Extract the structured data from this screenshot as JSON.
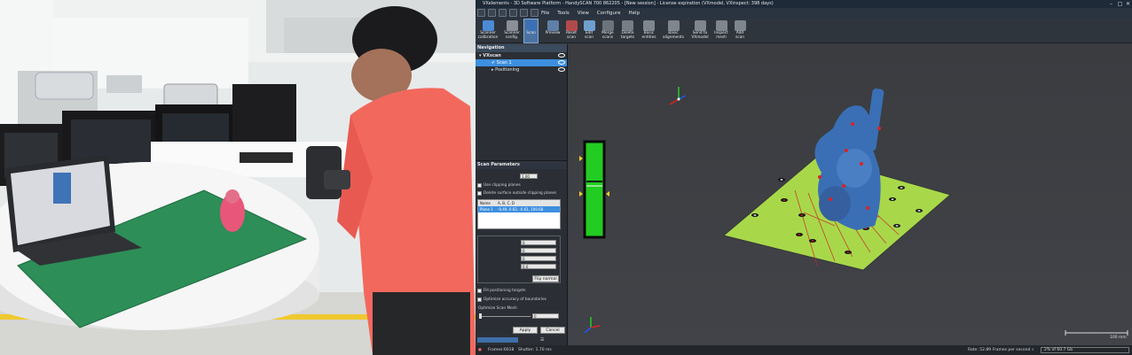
{
  "app": {
    "title": "VXelements - 3D Software Platform - HandySCAN 700 862205 - [New session] - License expiration (VXmodel, VXinspect: 398 days)",
    "window_buttons": [
      "–",
      "□",
      "✕"
    ],
    "menu": [
      "File",
      "Tools",
      "View",
      "Configure",
      "Help"
    ],
    "toolbar": [
      {
        "label": "Scanner\ncalibration",
        "icon": "calibration-icon"
      },
      {
        "label": "Scanner\nconfig.",
        "icon": "scanner-config-icon"
      },
      {
        "label": "Scan",
        "icon": "scan-icon",
        "active": true
      },
      {
        "label": "Preview",
        "icon": "preview-icon"
      },
      {
        "label": "Reset\nscan",
        "icon": "reset-icon"
      },
      {
        "label": "Edit\nscan",
        "icon": "edit-icon"
      },
      {
        "label": "Merge\nscans",
        "icon": "merge-icon"
      },
      {
        "label": "Delete\ntargets",
        "icon": "delete-targets-icon"
      },
      {
        "label": "Basic\nentities",
        "icon": "entities-icon"
      },
      {
        "label": "Basic\nalignments",
        "icon": "alignments-icon"
      },
      {
        "label": "Send to\nVXmodel",
        "icon": "send-icon"
      },
      {
        "label": "Inspect\nmesh",
        "icon": "inspect-icon"
      },
      {
        "label": "Add\nscan",
        "icon": "add-scan-icon"
      }
    ],
    "navigation": {
      "title": "Navigation",
      "root": "VXscan",
      "items": [
        {
          "label": "Scan 1",
          "selected": true
        },
        {
          "label": "Positioning",
          "selected": false
        }
      ]
    },
    "scan_params": {
      "title": "Scan Parameters",
      "resolution_value": "1.00",
      "use_clipping_planes": "Use clipping planes",
      "delete_surface": "Delete surface outside clipping planes",
      "table_headers": [
        "Name",
        "A, B, C, D"
      ],
      "table_rows": [
        [
          "Plane 1",
          "-0.49, 0.62, -0.61, 100.68"
        ]
      ],
      "fields": [
        "0",
        "0",
        "0",
        "0.0"
      ],
      "flip_normal": "Flip normal",
      "fill_targets": "Fill positioning targets",
      "optimize_accuracy": "Optimize accuracy of boundaries",
      "optimize_mesh": "Optimize Scan Mesh",
      "slider_value": "0",
      "apply": "Apply",
      "cancel": "Cancel"
    },
    "status": {
      "frames": "Frames:6018",
      "shutter": "Shutter: 1.70 ms",
      "rate": "Rate: 52.89 Frames per second",
      "memory": "2% of 60.7 Gb",
      "scale": "100 mm"
    },
    "colors": {
      "accent": "#3d8fe0",
      "scan_blue": "#3a6fb5",
      "plate_green": "#a8d84a",
      "trigger_green": "#22cc22"
    }
  }
}
